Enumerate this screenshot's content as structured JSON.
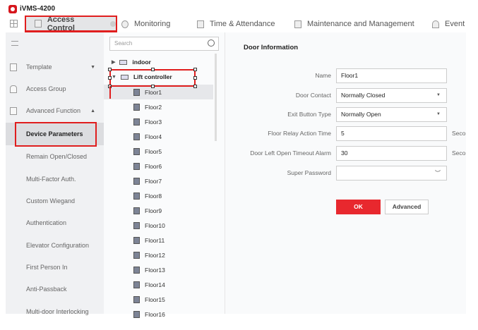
{
  "app": {
    "title": "iVMS-4200"
  },
  "tabs": [
    {
      "label": "Access Control"
    },
    {
      "label": "Monitoring"
    },
    {
      "label": "Time & Attendance"
    },
    {
      "label": "Maintenance and Management"
    },
    {
      "label": "Event"
    }
  ],
  "sidebar": {
    "items": [
      {
        "label": "Template"
      },
      {
        "label": "Access Group"
      },
      {
        "label": "Advanced Function"
      },
      {
        "label": "Device Parameters"
      },
      {
        "label": "Remain Open/Closed"
      },
      {
        "label": "Multi-Factor Auth."
      },
      {
        "label": "Custom Wiegand"
      },
      {
        "label": "Authentication"
      },
      {
        "label": "Elevator Configuration"
      },
      {
        "label": "First Person In"
      },
      {
        "label": "Anti-Passback"
      },
      {
        "label": "Multi-door Interlocking"
      }
    ]
  },
  "tree": {
    "search_placeholder": "Search",
    "devices": [
      {
        "label": "indoor"
      },
      {
        "label": "Lift controller"
      }
    ],
    "floors": [
      "Floor1",
      "Floor2",
      "Floor3",
      "Floor4",
      "Floor5",
      "Floor6",
      "Floor7",
      "Floor8",
      "Floor9",
      "Floor10",
      "Floor11",
      "Floor12",
      "Floor13",
      "Floor14",
      "Floor15",
      "Floor16"
    ]
  },
  "form": {
    "title": "Door Information",
    "fields": [
      {
        "label": "Name",
        "value": "Floor1"
      },
      {
        "label": "Door Contact",
        "value": "Normally Closed"
      },
      {
        "label": "Exit Button Type",
        "value": "Normally Open"
      },
      {
        "label": "Floor Relay Action Time",
        "value": "5",
        "unit": "Seconds"
      },
      {
        "label": "Door Left Open Timeout Alarm",
        "value": "30",
        "unit": "Seconds"
      },
      {
        "label": "Super Password",
        "value": ""
      }
    ],
    "ok_label": "OK",
    "advanced_label": "Advanced"
  }
}
